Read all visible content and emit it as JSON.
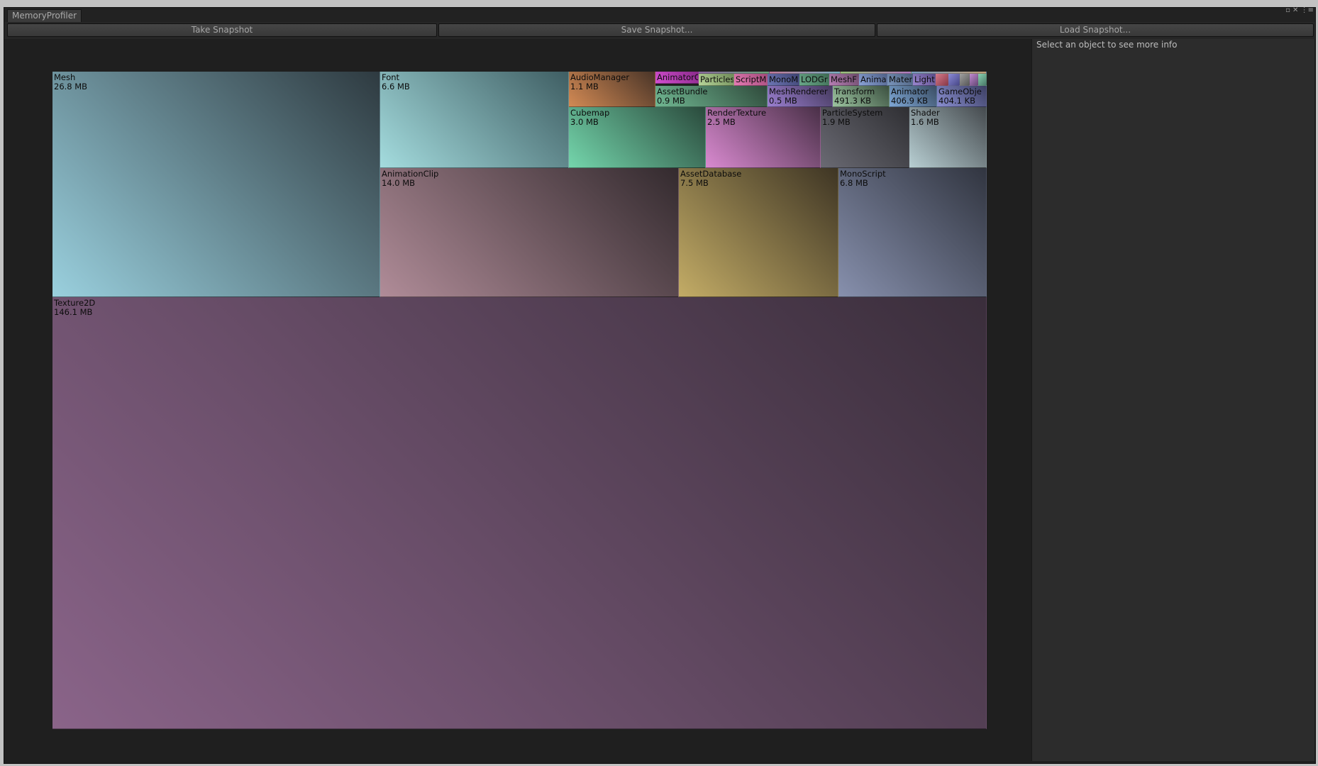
{
  "window": {
    "tab_title": "MemoryProfiler",
    "controls": "▫ ✕ ⋮≡"
  },
  "toolbar": {
    "take_label": "Take Snapshot",
    "save_label": "Save Snapshot...",
    "load_label": "Load Snapshot..."
  },
  "sidebar": {
    "info_text": "Select an object to see more info"
  },
  "treemap": {
    "Mesh": {
      "name": "Mesh",
      "size": "26.8 MB"
    },
    "Font": {
      "name": "Font",
      "size": "6.6 MB"
    },
    "AudioManager": {
      "name": "AudioManager",
      "size": "1.1 MB"
    },
    "AnimatorC": {
      "name": "AnimatorC"
    },
    "ParticleS": {
      "name": "Particles"
    },
    "ScriptM": {
      "name": "ScriptM"
    },
    "MonoM": {
      "name": "MonoM"
    },
    "LODGr": {
      "name": "LODGr"
    },
    "MeshF": {
      "name": "MeshF"
    },
    "Anima": {
      "name": "Anima"
    },
    "Mater": {
      "name": "Mater"
    },
    "Light": {
      "name": "Light"
    },
    "AssetBundle": {
      "name": "AssetBundle",
      "size": "0.9 MB"
    },
    "MeshRenderer": {
      "name": "MeshRenderer",
      "size": "0.5 MB"
    },
    "Transform": {
      "name": "Transform",
      "size": "491.3 KB"
    },
    "Animator": {
      "name": "Animator",
      "size": "406.9 KB"
    },
    "GameObje": {
      "name": "GameObje",
      "size": "404.1 KB"
    },
    "Cubemap": {
      "name": "Cubemap",
      "size": "3.0 MB"
    },
    "RenderTexture": {
      "name": "RenderTexture",
      "size": "2.5 MB"
    },
    "ParticleSystem": {
      "name": "ParticleSystem",
      "size": "1.9 MB"
    },
    "Shader": {
      "name": "Shader",
      "size": "1.6 MB"
    },
    "AnimationClip": {
      "name": "AnimationClip",
      "size": "14.0 MB"
    },
    "AssetDatabase": {
      "name": "AssetDatabase",
      "size": "7.5 MB"
    },
    "MonoScript": {
      "name": "MonoScript",
      "size": "6.8 MB"
    },
    "Texture2D": {
      "name": "Texture2D",
      "size": "146.1 MB"
    }
  },
  "colors": {
    "Mesh": [
      "#9ad0de",
      "#2e3a40"
    ],
    "Font": [
      "#a4dcde",
      "#3f5e63"
    ],
    "AudioManager": [
      "#d38a54",
      "#4a3528"
    ],
    "AnimatorC": [
      "#d44fd2",
      "#8a2a8a"
    ],
    "ParticleS": [
      "#b8d69a",
      "#6e8a58"
    ],
    "ScriptM": [
      "#e57bb4",
      "#a24b7a"
    ],
    "MonoM": [
      "#6d77b5",
      "#3d4270"
    ],
    "LODGr": [
      "#6aa88a",
      "#3d6a52"
    ],
    "MeshF": [
      "#b77fb5",
      "#6c4b6a"
    ],
    "Anima": [
      "#8aa3d6",
      "#4f6087"
    ],
    "Mater": [
      "#7c97be",
      "#4a5d7a"
    ],
    "Light": [
      "#9a86cf",
      "#5a4c88"
    ],
    "AssetBundle": [
      "#70b792",
      "#2f4a3b"
    ],
    "MeshRenderer": [
      "#9b7fd0",
      "#453a5e"
    ],
    "Transform": [
      "#9cc4a0",
      "#3b5040"
    ],
    "Animator": [
      "#7ea7d6",
      "#3a4d63"
    ],
    "GameObje": [
      "#8a8fd1",
      "#3c3f63"
    ],
    "Cubemap": [
      "#74d6ac",
      "#2a4a3c"
    ],
    "RenderTexture": [
      "#d98ad0",
      "#4a3048"
    ],
    "ParticleSystem": [
      "#6a6a73",
      "#2f2f33"
    ],
    "Shader": [
      "#b8cfd3",
      "#454a4e"
    ],
    "AnimationClip": [
      "#b08c98",
      "#332a2e"
    ],
    "AssetDatabase": [
      "#c3ac66",
      "#3e3524"
    ],
    "MonoScript": [
      "#8790ad",
      "#313540"
    ],
    "Texture2D": [
      "#8a6489",
      "#3a2e3b"
    ]
  }
}
